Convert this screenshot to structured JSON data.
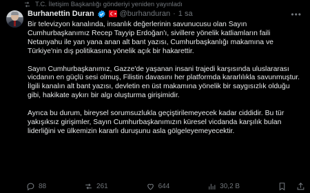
{
  "repost": {
    "text": "T.C. İletişim Başkanlığı gönderiyi yeniden yayınladı"
  },
  "author": {
    "name": "Burhanettin Duran",
    "handle": "@burhanduran",
    "separator": "·",
    "time": "1 sa"
  },
  "post": {
    "paragraphs": [
      "Bir televizyon kanalında, insanlık değerlerinin savunucusu olan Sayın Cumhurbaşkanımız Recep Tayyip Erdoğan'ı, sivillere yönelik katliamların faili Netanyahu ile yan yana anan alt bant yazısı, Cumhurbaşkanlığı makamına ve Türkiye'nin dış politikasına yönelik açık bir hakarettir.",
      "Sayın Cumhurbaşkanımız, Gazze'de yaşanan insani trajedi karşısında uluslararası vicdanın en güçlü sesi olmuş, Filistin davasını her platformda kararlılıkla savunmuştur. İlgili kanalın alt bant yazısı, devletin en üst makamına yönelik bir saygısızlık olduğu gibi, hakikate aykırı bir algı oluşturma girişimidir.",
      "Ayrıca bu durum, bireysel sorumsuzlukla geçiştirilemeyecek kadar ciddidir. Bu tür yakışıksız girişimler, Sayın Cumhurbaşkanımızın küresel vicdanda karşılık bulan liderliğini ve ülkemizin kararlı duruşunu asla gölgeleyemeyecektir."
    ]
  },
  "actions": {
    "replies": "88",
    "reposts": "261",
    "likes": "644",
    "views": "30,2 B"
  },
  "colors": {
    "background": "#000000",
    "text": "#e7e9ea",
    "muted": "#71767b",
    "verified": "#1d9bf0",
    "flag_red": "#e30a17"
  }
}
